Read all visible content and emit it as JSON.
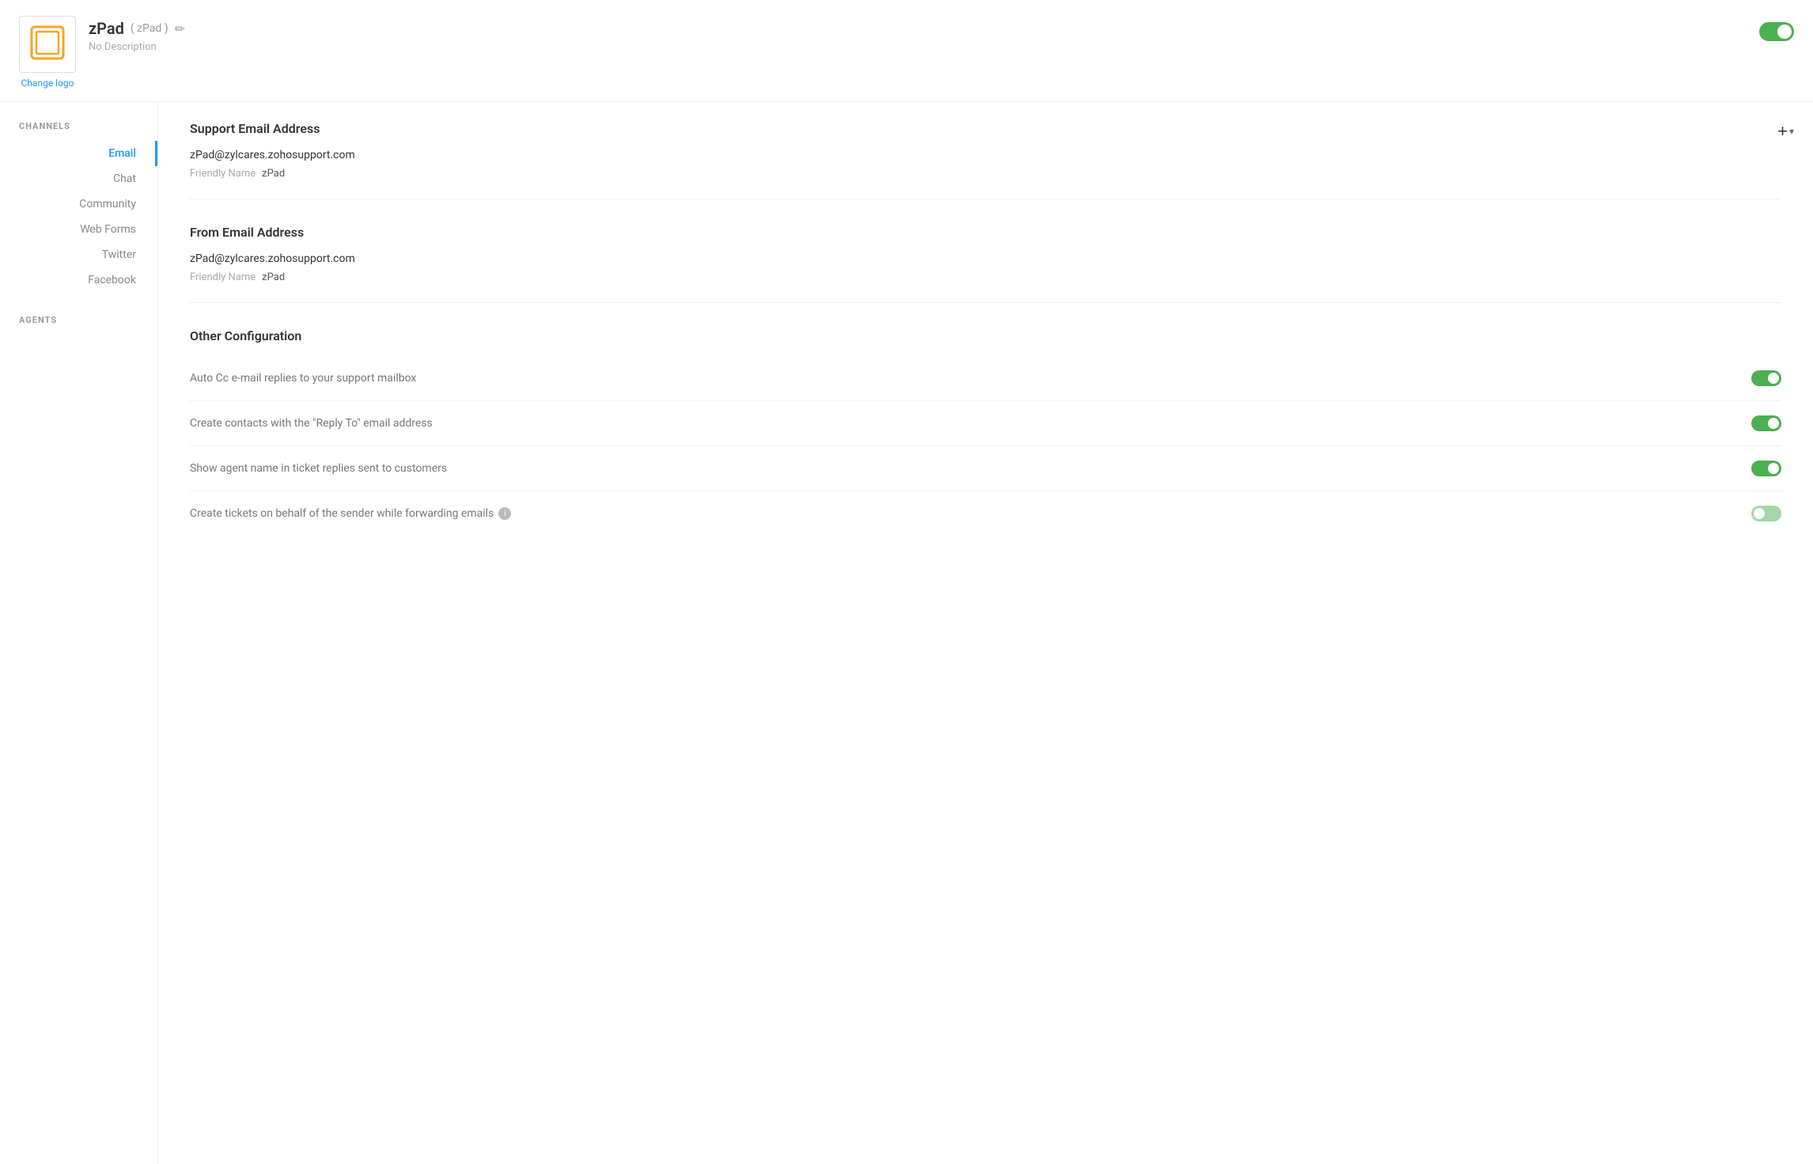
{
  "header": {
    "app_name": "zPad",
    "app_alias": "( zPad )",
    "description": "No Description",
    "change_logo": "Change logo",
    "enabled": true
  },
  "sidebar": {
    "channels_label": "CHANNELS",
    "agents_label": "AGENTS",
    "channels": [
      {
        "id": "email",
        "label": "Email",
        "active": true
      },
      {
        "id": "chat",
        "label": "Chat",
        "active": false
      },
      {
        "id": "community",
        "label": "Community",
        "active": false
      },
      {
        "id": "web-forms",
        "label": "Web Forms",
        "active": false
      },
      {
        "id": "twitter",
        "label": "Twitter",
        "active": false
      },
      {
        "id": "facebook",
        "label": "Facebook",
        "active": false
      }
    ]
  },
  "content": {
    "add_button": "+",
    "sections": {
      "support_email": {
        "title": "Support Email Address",
        "email": "zPad@zylcares.zohosupport.com",
        "friendly_label": "Friendly Name",
        "friendly_value": "zPad"
      },
      "from_email": {
        "title": "From Email Address",
        "email": "zPad@zylcares.zohosupport.com",
        "friendly_label": "Friendly Name",
        "friendly_value": "zPad"
      },
      "other_config": {
        "title": "Other Configuration",
        "items": [
          {
            "id": "auto-cc",
            "label": "Auto Cc e-mail replies to your support mailbox",
            "enabled": true,
            "has_info": false
          },
          {
            "id": "create-contacts",
            "label": "Create contacts with the \"Reply To\" email address",
            "enabled": true,
            "has_info": false
          },
          {
            "id": "show-agent-name",
            "label": "Show agent name in ticket replies sent to customers",
            "enabled": true,
            "has_info": false
          },
          {
            "id": "create-tickets",
            "label": "Create tickets on behalf of the sender while forwarding emails",
            "enabled": false,
            "has_info": true
          }
        ]
      }
    }
  }
}
